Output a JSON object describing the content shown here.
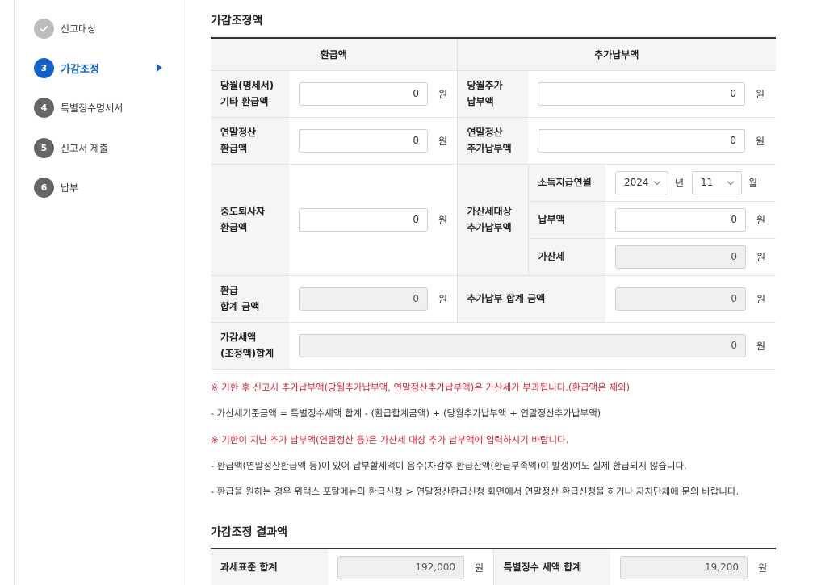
{
  "sidebar": {
    "steps": [
      {
        "num": "",
        "label": "신고대상",
        "state": "done"
      },
      {
        "num": "3",
        "label": "가감조정",
        "state": "active"
      },
      {
        "num": "4",
        "label": "특별징수명세서",
        "state": "normal"
      },
      {
        "num": "5",
        "label": "신고서 제출",
        "state": "normal"
      },
      {
        "num": "6",
        "label": "납부",
        "state": "normal"
      }
    ]
  },
  "adjust": {
    "title": "가감조정액",
    "col_refund": "환급액",
    "col_additional": "추가납부액",
    "unit": "원",
    "rows": {
      "monthly_refund_label_1": "당월(명세서)",
      "monthly_refund_label_2": "기타 환급액",
      "monthly_refund_value": "0",
      "monthly_add_label_1": "당월추가",
      "monthly_add_label_2": "납부액",
      "monthly_add_value": "0",
      "yearend_refund_label_1": "연말정산",
      "yearend_refund_label_2": "환급액",
      "yearend_refund_value": "0",
      "yearend_add_label_1": "연말정산",
      "yearend_add_label_2": "추가납부액",
      "yearend_add_value": "0",
      "midterm_refund_label_1": "중도퇴사자",
      "midterm_refund_label_2": "환급액",
      "midterm_refund_value": "0",
      "penalty_label_1": "가산세대상",
      "penalty_label_2": "추가납부액",
      "income_month_label": "소득지급연월",
      "year_value": "2024",
      "year_unit": "년",
      "month_value": "11",
      "month_unit": "월",
      "pay_amount_label": "납부액",
      "pay_amount_value": "0",
      "penalty_tax_label": "가산세",
      "penalty_tax_value": "0",
      "refund_total_label_1": "환급",
      "refund_total_label_2": "합계 금액",
      "refund_total_value": "0",
      "add_total_label": "추가납부 합계 금액",
      "add_total_value": "0",
      "adj_total_label_1": "가감세액",
      "adj_total_label_2": "(조정액)합계",
      "adj_total_value": "0"
    }
  },
  "notes": [
    {
      "text": "※ 기한 후 신고시 추가납부액(당월추가납부액, 연말정산추가납부액)은 가산세가 부과됩니다.(환급액은 제외)",
      "color": "#d6203a"
    },
    {
      "text": "- 가산세기준금액 = 특별징수세액 합계 - (환급합계금액) + (당월추가납부액 + 연말정산추가납부액)",
      "color": "#333333"
    },
    {
      "text": "※ 기한이 지난 추가 납부액(연말정산 등)은 가산세 대상 추가 납부액에 입력하시기 바랍니다.",
      "color": "#d6203a"
    },
    {
      "text": "- 환급액(연말정산환급액 등)이 있어 납부할세액이 음수(차감후 환급잔액(환급부족액)이 발생)여도 실제 환급되지 않습니다.",
      "color": "#333333"
    },
    {
      "text": "- 환급을 원하는 경우 위택스 포탈메뉴의 환급신청 > 연말정산환급신청 화면에서 연말정산 환급신청을 하거나 자치단체에 문의 바랍니다.",
      "color": "#333333"
    }
  ],
  "result": {
    "title": "가감조정 결과액",
    "taxbase_label": "과세표준 합계",
    "taxbase_value": "192,000",
    "special_tax_label": "특별징수 세액 합계",
    "special_tax_value": "19,200",
    "unit": "원"
  },
  "colors": {
    "accent": "#1560c4",
    "warning": "#d6203a",
    "header_bg": "#f5f5f5"
  }
}
